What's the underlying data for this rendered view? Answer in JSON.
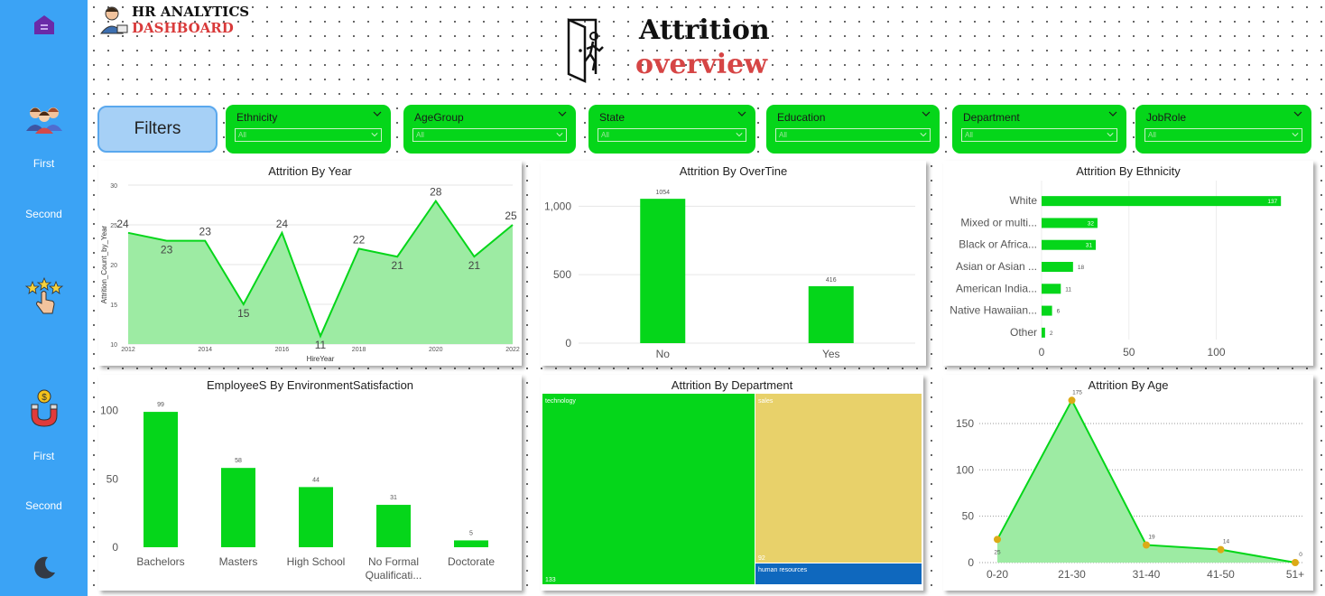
{
  "brand": {
    "line1": "HR ANALYTICS",
    "line2": "DASHBOARD"
  },
  "header": {
    "title_line1": "Attrition",
    "title_line2": "overview"
  },
  "sidebar": {
    "items": [
      {
        "label": "First"
      },
      {
        "label": "Second"
      },
      {
        "label": "First"
      },
      {
        "label": "Second"
      }
    ]
  },
  "filters_button": "Filters",
  "slicers": [
    {
      "title": "Ethnicity",
      "value": "All"
    },
    {
      "title": "AgeGroup",
      "value": "All"
    },
    {
      "title": "State",
      "value": "All"
    },
    {
      "title": "Education",
      "value": "All"
    },
    {
      "title": "Department",
      "value": "All"
    },
    {
      "title": "JobRole",
      "value": "All"
    }
  ],
  "colors": {
    "green": "#05d61a",
    "area_fill": "#9deba3",
    "sidebar": "#3ba3f5",
    "sales": "#e8d16a",
    "hr": "#0f68be",
    "age_point": "#dcaa17",
    "accent_red": "#d93a3a"
  },
  "icons": [
    "home-icon",
    "people-icon",
    "star-hand-icon",
    "magnet-money-icon",
    "moon-icon",
    "door-exit-icon",
    "hr-person-icon"
  ],
  "chart_data": [
    {
      "id": "year",
      "type": "area",
      "title": "Attrition By Year",
      "xlabel": "HireYear",
      "ylabel": "Attrition_Count_by_Year",
      "x": [
        2012,
        2013,
        2014,
        2015,
        2016,
        2017,
        2018,
        2019,
        2020,
        2021,
        2022
      ],
      "values": [
        24,
        23,
        23,
        15,
        24,
        11,
        22,
        21,
        28,
        21,
        25
      ],
      "xticks": [
        "2012",
        "2014",
        "2016",
        "2018",
        "2020",
        "2022"
      ],
      "yticks": [
        "10",
        "15",
        "20",
        "25",
        "30"
      ],
      "xlim": [
        2012,
        2022
      ],
      "ylim": [
        10,
        30
      ]
    },
    {
      "id": "overtime",
      "type": "bar",
      "title": "Attrition By OverTine",
      "categories": [
        "No",
        "Yes"
      ],
      "values": [
        1054,
        416
      ],
      "yticks": [
        "0",
        "500",
        "1,000"
      ],
      "ylim": [
        0,
        1200
      ]
    },
    {
      "id": "ethnicity",
      "type": "bar",
      "orientation": "horizontal",
      "title": "Attrition By Ethnicity",
      "categories": [
        "White",
        "Mixed or multi...",
        "Black or Africa...",
        "Asian or Asian ...",
        "American India...",
        "Native Hawaiian...",
        "Other"
      ],
      "values": [
        137,
        32,
        31,
        18,
        11,
        6,
        2
      ],
      "xticks": [
        "0",
        "50",
        "100"
      ],
      "xlim": [
        0,
        140
      ]
    },
    {
      "id": "environment",
      "type": "bar",
      "title": "EmployeeS By EnvironmentSatisfaction",
      "categories": [
        "Bachelors",
        "Masters",
        "High School",
        "No Formal Qualificati...",
        "Doctorate"
      ],
      "values": [
        99,
        58,
        44,
        31,
        5
      ],
      "yticks": [
        "0",
        "50",
        "100"
      ],
      "ylim": [
        0,
        105
      ]
    },
    {
      "id": "department",
      "type": "treemap",
      "title": "Attrition By Department",
      "categories": [
        "technology",
        "sales",
        "human resources"
      ],
      "values": [
        133,
        92,
        null
      ]
    },
    {
      "id": "age",
      "type": "area",
      "title": "Attrition By Age",
      "categories": [
        "0-20",
        "21-30",
        "31-40",
        "41-50",
        "51+"
      ],
      "values": [
        25,
        175,
        19,
        14,
        0
      ],
      "yticks": [
        "0",
        "50",
        "100",
        "150"
      ],
      "ylim": [
        0,
        185
      ]
    }
  ]
}
